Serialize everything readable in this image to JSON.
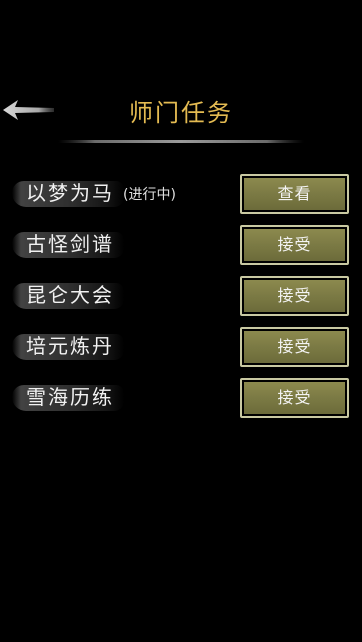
{
  "header": {
    "title": "师门任务",
    "back_icon": "back-arrow-icon"
  },
  "colors": {
    "title": "#e4bb52",
    "button_fill": "#7b7a44",
    "button_border": "#c9c9a2",
    "background": "#000000"
  },
  "tasks": [
    {
      "name": "以梦为马",
      "status": "(进行中)",
      "button_label": "查看"
    },
    {
      "name": "古怪剑谱",
      "status": "",
      "button_label": "接受"
    },
    {
      "name": "昆仑大会",
      "status": "",
      "button_label": "接受"
    },
    {
      "name": "培元炼丹",
      "status": "",
      "button_label": "接受"
    },
    {
      "name": "雪海历练",
      "status": "",
      "button_label": "接受"
    }
  ]
}
